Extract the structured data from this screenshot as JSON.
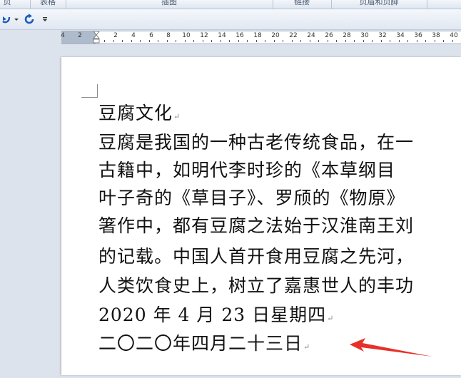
{
  "ribbon": {
    "groups": [
      {
        "label": "页"
      },
      {
        "label": "表格"
      },
      {
        "label": "插图"
      },
      {
        "label": "链接"
      },
      {
        "label": "页眉和页脚"
      }
    ]
  },
  "quick_access": {
    "undo_icon": "undo-icon",
    "redo_icon": "redo-icon",
    "customize_icon": "customize-qat-icon"
  },
  "ruler": {
    "labels": [
      "4",
      "2",
      "",
      "2",
      "4",
      "6",
      "8",
      "10",
      "12",
      "14",
      "16",
      "18",
      "20",
      "22",
      "24",
      "26",
      "28",
      "30",
      "32",
      "34",
      "36",
      "38",
      "40"
    ]
  },
  "document": {
    "lines": [
      {
        "text": "豆腐文化",
        "mark": "↵"
      },
      {
        "text": "豆腐是我国的一种古老传统食品，在一",
        "mark": ""
      },
      {
        "text": "古籍中，如明代李时珍的《本草纲目",
        "mark": ""
      },
      {
        "text": "叶子奇的《草目子》、罗颀的《物原》",
        "mark": ""
      },
      {
        "text": "箸作中，都有豆腐之法始于汉淮南王刘",
        "mark": ""
      },
      {
        "text": "的记载。中国人首开食用豆腐之先河，",
        "mark": ""
      },
      {
        "text": "人类饮食史上，树立了嘉惠世人的丰功",
        "mark": ""
      },
      {
        "text": "2020 年 4 月 23 日星期四",
        "mark": "↵"
      },
      {
        "text": "二〇二〇年四月二十三日",
        "mark": "↵"
      }
    ]
  },
  "annotation": {
    "arrow_color": "#e8302a"
  }
}
